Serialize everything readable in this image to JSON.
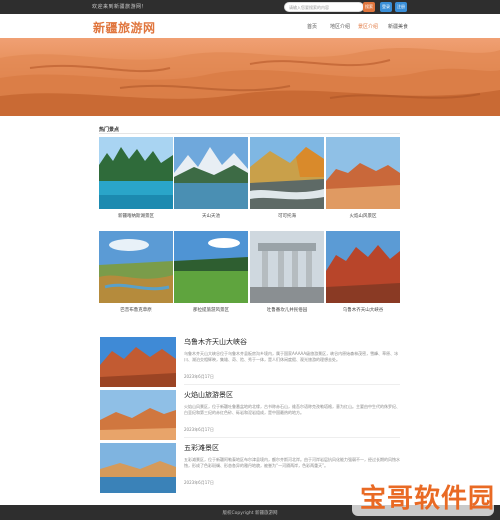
{
  "topbar": {
    "welcome": "欢迎来到新疆旅游网！",
    "search_placeholder": "请输入您要搜索的内容",
    "search_label": "搜索",
    "login_label": "登录",
    "register_label": "注册"
  },
  "nav": {
    "logo": "新疆旅游网",
    "items": [
      {
        "label": "首页"
      },
      {
        "label": "地区介绍"
      },
      {
        "label": "景区介绍"
      },
      {
        "label": "新疆美食"
      }
    ]
  },
  "section": {
    "title": "热门景点"
  },
  "attractions": [
    {
      "caption": "新疆喀纳斯湖景区"
    },
    {
      "caption": "天山天池"
    },
    {
      "caption": "可可托海"
    },
    {
      "caption": "火焰山风景区"
    },
    {
      "caption": "巴音布鲁克草原"
    },
    {
      "caption": "那拉提旅游风景区"
    },
    {
      "caption": "吐鲁番坎儿井民俗园"
    },
    {
      "caption": "乌鲁木齐天山大峡谷"
    }
  ],
  "articles": [
    {
      "title": "乌鲁木齐天山大峡谷",
      "excerpt": "乌鲁木齐天山大峡谷位于乌鲁木齐县板房沟乡境内，属于国家AAAAA级旅游景区，峡谷内原始森林茂密，雪峰、草原、冰川、湖泊交相辉映，集雄、奇、险、秀于一体，是人们休闲度假、观光旅游的理想去处。",
      "date": "2023年6月17日"
    },
    {
      "title": "火焰山旅游景区",
      "excerpt": "火焰山风景区，位于新疆吐鲁番盆地的北缘，古书称赤石山，维吾尔语称克孜勒塔格，意为红山。主要由中生代的侏罗纪、白垩纪和第三纪的赤红色砂、砾岩和泥岩组成，是中国最热的地方。",
      "date": "2023年6月17日"
    },
    {
      "title": "五彩滩景区",
      "excerpt": "五彩滩景区，位于新疆阿勒泰地区布尔津县境内，额尔齐斯河北岸。由于河岸岩层抗风化能力强弱不一，经过长期的风蚀水蚀，形成了色彩斑斓、形态各异的雅丹地貌，被誉为“一河隔两岸，色彩两重天”。",
      "date": "2023年6月17日"
    }
  ],
  "footer": {
    "copyright": "版权Copyright 新疆旅游网"
  },
  "watermark": {
    "text": "宝哥软件园"
  },
  "colors": {
    "accent": "#e0763e",
    "topbar": "#2e2e2e",
    "button_blue": "#3a8fd8"
  }
}
